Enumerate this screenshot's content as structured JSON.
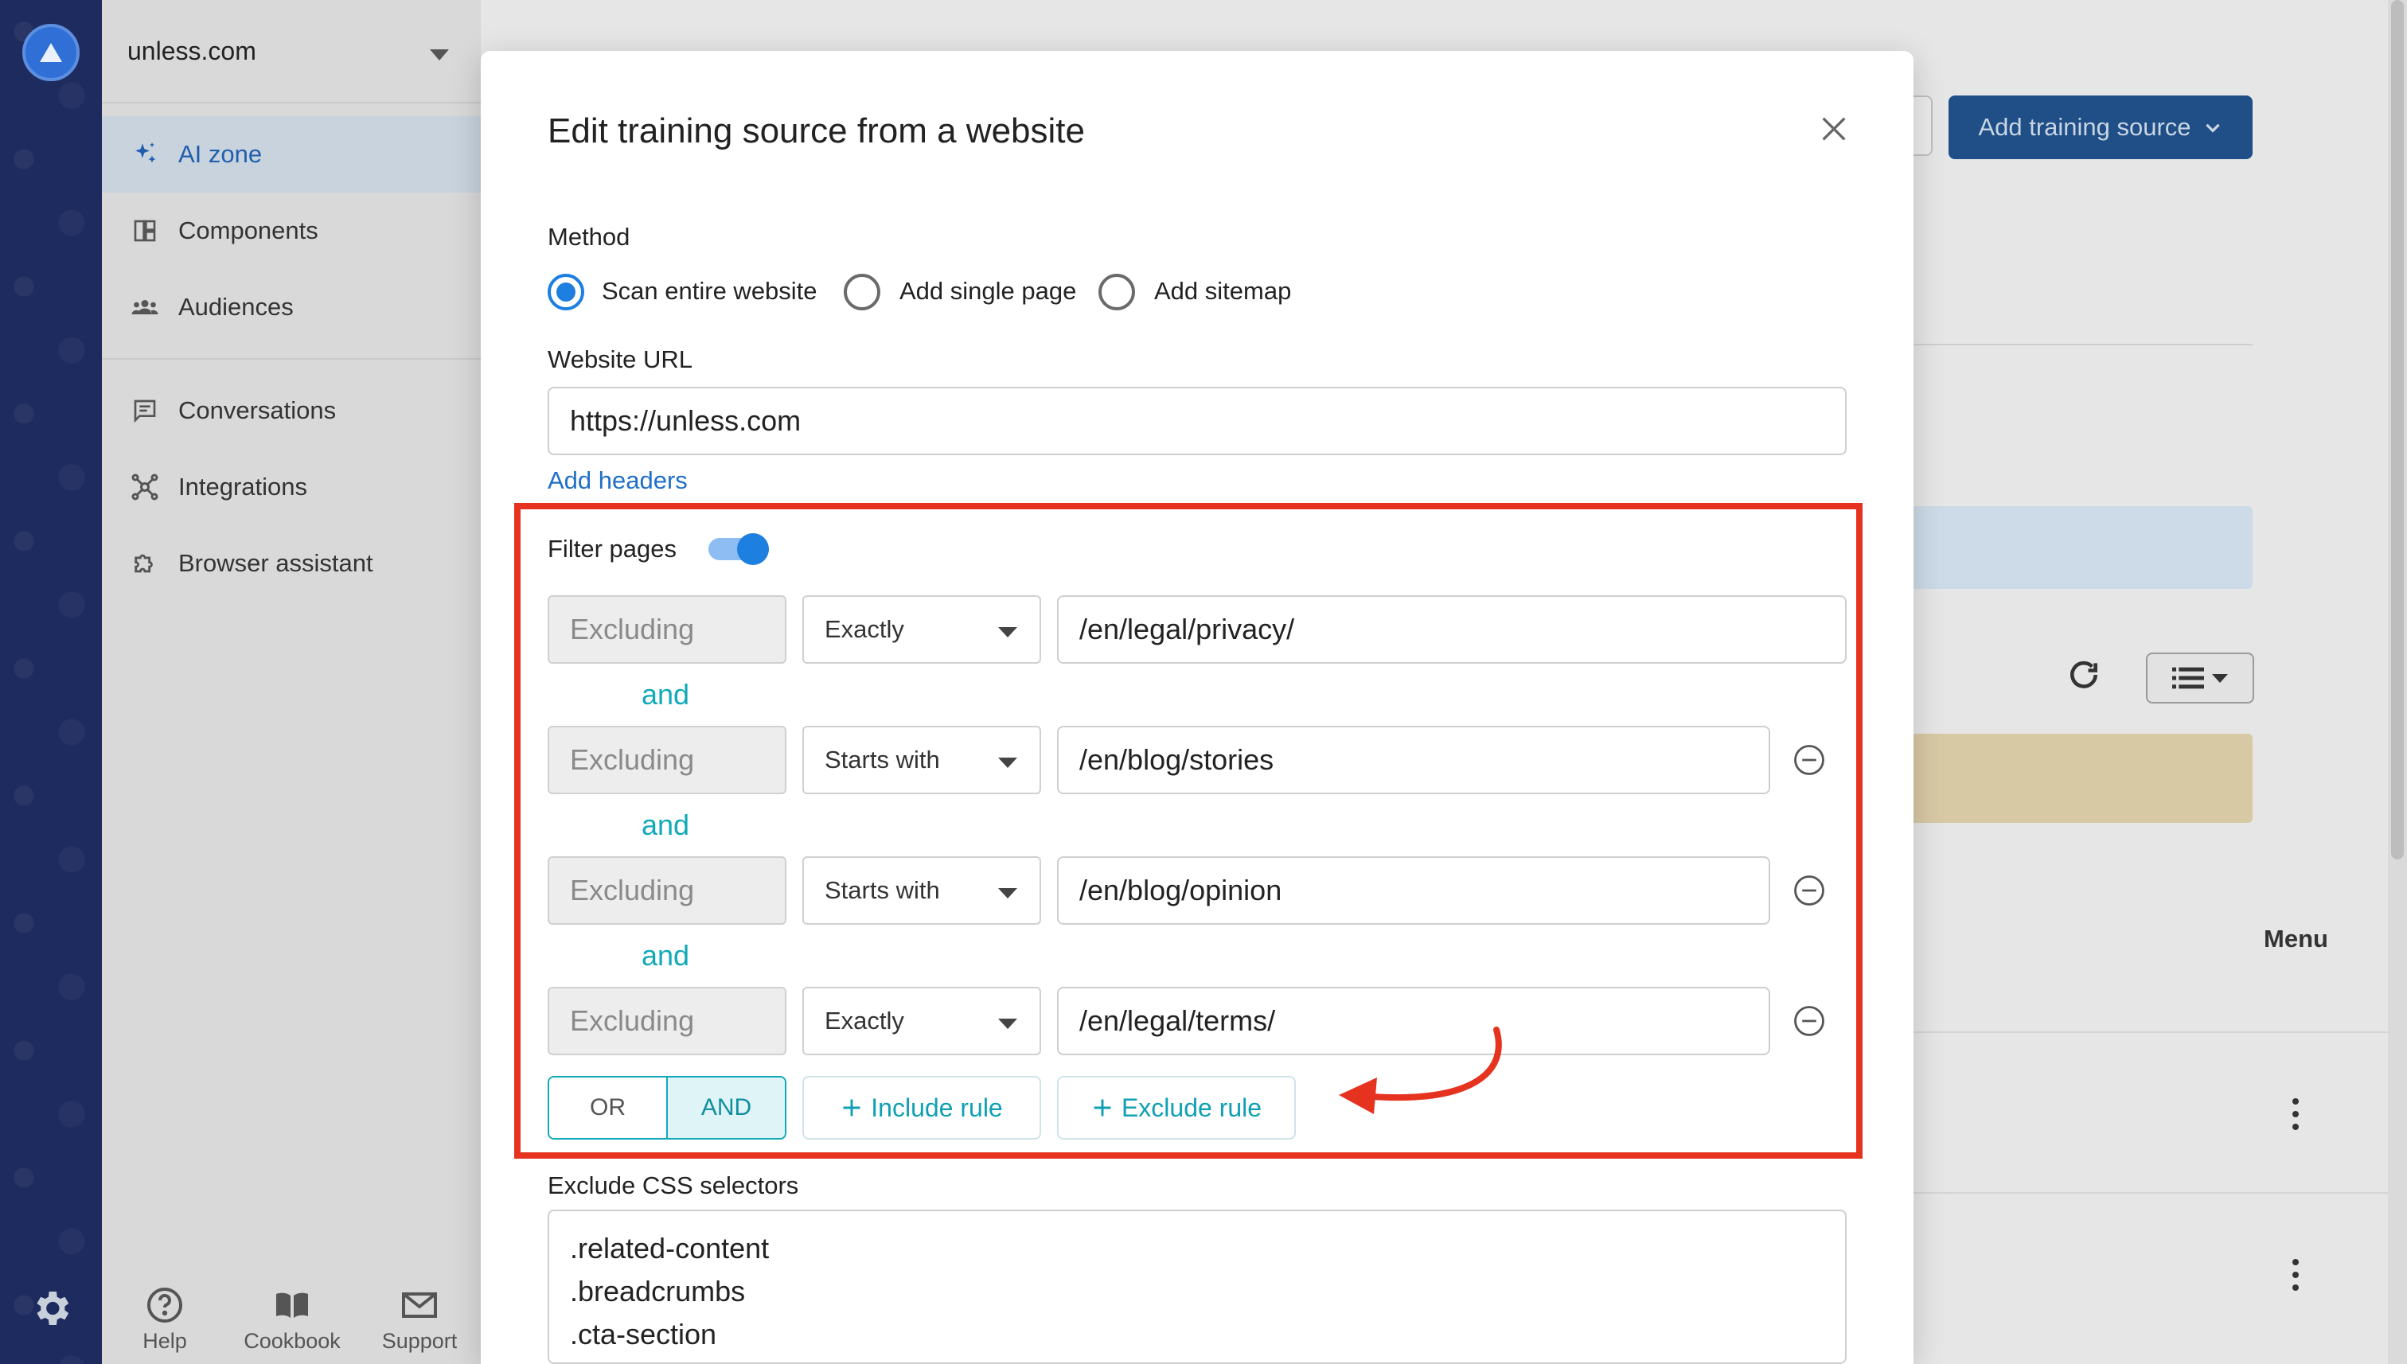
{
  "sidebar": {
    "org": "unless.com",
    "items": [
      {
        "label": "AI zone",
        "icon": "sparkles-icon",
        "active": true
      },
      {
        "label": "Components",
        "icon": "components-icon"
      },
      {
        "label": "Audiences",
        "icon": "audiences-icon"
      },
      {
        "label": "Conversations",
        "icon": "chat-icon"
      },
      {
        "label": "Integrations",
        "icon": "integrations-icon"
      },
      {
        "label": "Browser assistant",
        "icon": "puzzle-icon"
      }
    ],
    "bottom": [
      {
        "label": "Help",
        "icon": "help-icon"
      },
      {
        "label": "Cookbook",
        "icon": "book-icon"
      },
      {
        "label": "Support",
        "icon": "mail-icon"
      }
    ]
  },
  "background": {
    "add_training_source": "Add training source",
    "menu_header": "Menu"
  },
  "modal": {
    "title": "Edit training source from a website",
    "method_label": "Method",
    "methods": [
      {
        "label": "Scan entire website",
        "selected": true
      },
      {
        "label": "Add single page",
        "selected": false
      },
      {
        "label": "Add sitemap",
        "selected": false
      }
    ],
    "url_label": "Website URL",
    "url_value": "https://unless.com",
    "add_headers": "Add headers",
    "filter_label": "Filter pages",
    "filter_enabled": true,
    "rules": [
      {
        "type": "Excluding",
        "match": "Exactly",
        "value": "/en/legal/privacy/"
      },
      {
        "type": "Excluding",
        "match": "Starts with",
        "value": "/en/blog/stories"
      },
      {
        "type": "Excluding",
        "match": "Starts with",
        "value": "/en/blog/opinion"
      },
      {
        "type": "Excluding",
        "match": "Exactly",
        "value": "/en/legal/terms/"
      }
    ],
    "connector": "and",
    "logic_or": "OR",
    "logic_and": "AND",
    "logic_selected": "AND",
    "include_rule": "Include rule",
    "exclude_rule": "Exclude rule",
    "css_label": "Exclude CSS selectors",
    "css_selectors": [
      ".related-content",
      ".breadcrumbs",
      ".cta-section"
    ]
  },
  "colors": {
    "accent": "#1d7fe0",
    "teal": "#10a9b8",
    "highlight": "#e63320",
    "rail": "#1e2b5e"
  }
}
